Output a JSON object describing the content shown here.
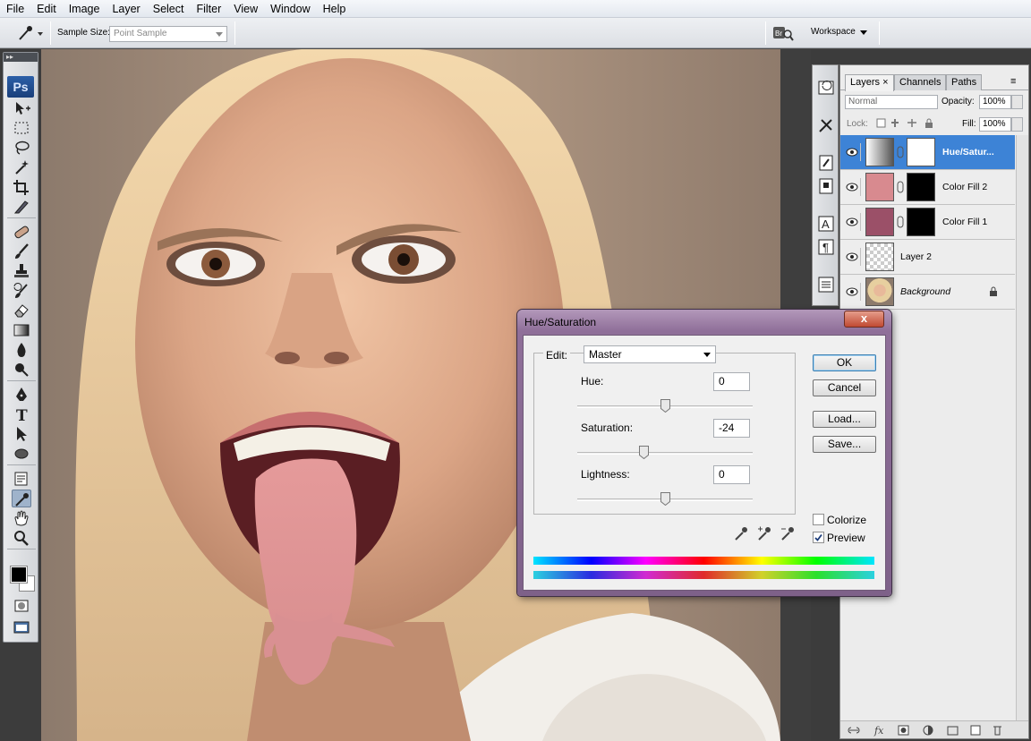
{
  "menubar": {
    "items": [
      "File",
      "Edit",
      "Image",
      "Layer",
      "Select",
      "Filter",
      "View",
      "Window",
      "Help"
    ]
  },
  "options": {
    "sample_size_label": "Sample Size:",
    "sample_size_value": "Point Sample",
    "workspace_label": "Workspace"
  },
  "toolbox": {
    "logo": "Ps"
  },
  "layers_panel": {
    "tabs": [
      "Layers",
      "Channels",
      "Paths"
    ],
    "active_tab": "Layers",
    "blend_mode": "Normal",
    "opacity_label": "Opacity:",
    "opacity_value": "100%",
    "lock_label": "Lock:",
    "fill_label": "Fill:",
    "fill_value": "100%",
    "layers": [
      {
        "name": "Hue/Satur...",
        "selected": true,
        "thumb_color": "#9a9a9a",
        "mask": "#ffffff"
      },
      {
        "name": "Color Fill 2",
        "selected": false,
        "thumb_color": "#d88a8f",
        "mask": "#000000"
      },
      {
        "name": "Color Fill 1",
        "selected": false,
        "thumb_color": "#9b5068",
        "mask": "#000000"
      },
      {
        "name": "Layer 2",
        "selected": false,
        "thumb_color": "checker",
        "mask": null
      },
      {
        "name": "Background",
        "selected": false,
        "thumb_color": "photo",
        "mask": null,
        "locked": true
      }
    ]
  },
  "dialog": {
    "title": "Hue/Saturation",
    "close_glyph": "x",
    "edit_label": "Edit:",
    "edit_value": "Master",
    "hue_label": "Hue:",
    "hue_value": "0",
    "hue_level": 0,
    "saturation_label": "Saturation:",
    "saturation_value": "-24",
    "saturation_level": -24,
    "lightness_label": "Lightness:",
    "lightness_value": "0",
    "lightness_level": 0,
    "buttons": {
      "ok": "OK",
      "cancel": "Cancel",
      "load": "Load...",
      "save": "Save..."
    },
    "colorize_label": "Colorize",
    "colorize_checked": false,
    "preview_label": "Preview",
    "preview_checked": true
  },
  "colors": {
    "selection_blue": "#3d83d6",
    "dialog_frame": "#8f6f99"
  }
}
